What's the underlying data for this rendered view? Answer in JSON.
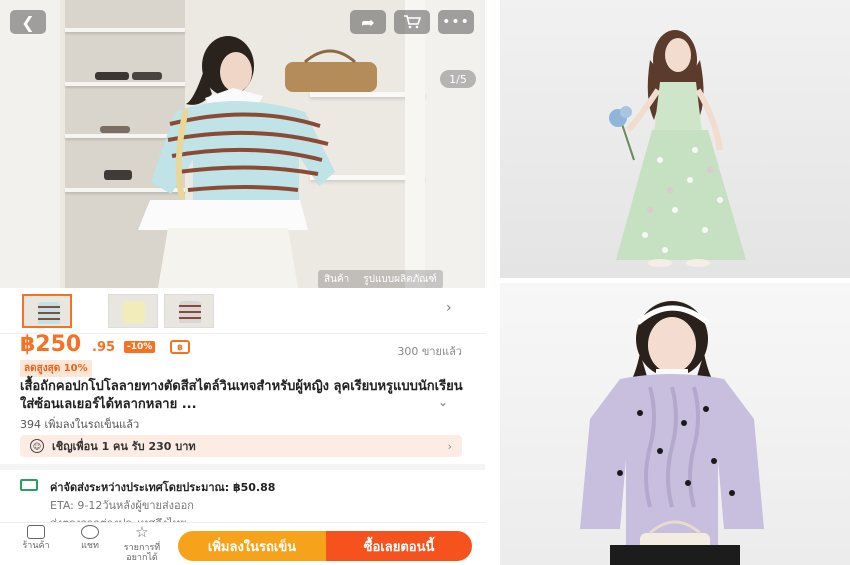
{
  "header": {
    "back_icon": "chevron-left-icon",
    "share_icon": "share-icon",
    "cart_icon": "cart-icon",
    "more_icon": "more-dots-icon",
    "image_counter": "1/5",
    "tabs": [
      "สินค้า",
      "รูปแบบผลิตภัณฑ์"
    ]
  },
  "thumbnails": {
    "count_shown": 3,
    "selected_index": 0
  },
  "price": {
    "currency": "฿",
    "whole": "฿250",
    "cents": ".95",
    "discount": "-10%",
    "sold": "300 ขายแล้ว",
    "max_discount": "ลดสูงสุด 10%"
  },
  "product": {
    "title": "เสื้อถักคอปกโปโลลายทางตัดสีสไตล์วินเทจสำหรับผู้หญิง ลุคเรียบหรูแบบนักเรียน ใส่ซ้อนเลเยอร์ได้หลากหลาย ...",
    "cart_count": "394 เพิ่มลงในรถเข็นแล้ว"
  },
  "invite": {
    "text": "เชิญเพื่อน 1 คน รับ 230 บาท"
  },
  "shipping": {
    "title": "ค่าจัดส่งระหว่างประเทศโดยประมาณ: ฿50.88",
    "eta": "ETA: 9-12วันหลังผู้ขายส่งออก",
    "origin": "ส่งตรงจากต่างประเทศถึงไทย"
  },
  "bottom_nav": {
    "store": "ร้านค้า",
    "chat": "แชท",
    "wishlist": "รายการที่อยากได้",
    "add_to_cart": "เพิ่มลงในรถเข็น",
    "buy_now": "ซื้อเลยตอนนี้"
  },
  "colors": {
    "accent": "#f57224",
    "add_to_cart_bg": "#f7a21b",
    "buy_now_bg": "#f5521e",
    "shipping_green": "#2aa05a"
  }
}
